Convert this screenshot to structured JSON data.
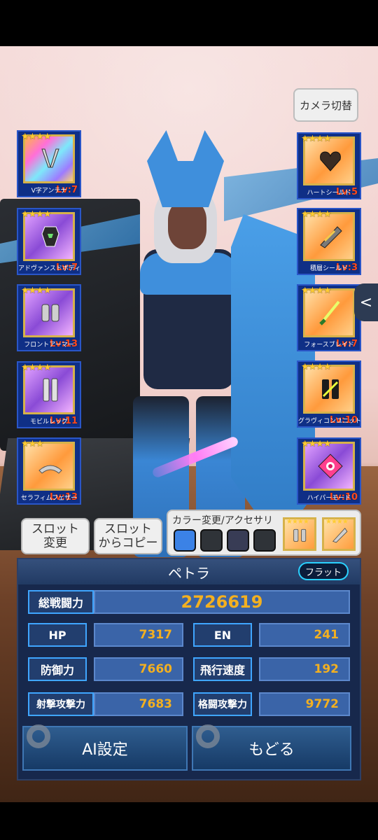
{
  "camera_button": "カメラ切替",
  "left_parts": [
    {
      "stars": "★★★★",
      "level": "Lv:7",
      "name": "V字アンテナ"
    },
    {
      "stars": "★★★★",
      "level": "Lv:7",
      "name": "アドヴァンスドボディ"
    },
    {
      "stars": "★★★★",
      "level": "Lv:13",
      "name": "フロントアーマー"
    },
    {
      "stars": "★★★★",
      "level": "Lv:11",
      "name": "モビルレッグ"
    },
    {
      "stars": "★★★",
      "level": "Lv:13",
      "name": "セラフィムフェザー"
    }
  ],
  "right_parts": [
    {
      "stars": "★★★★",
      "level": "Lv:5",
      "name": "ハートシールド"
    },
    {
      "stars": "★★★★",
      "level": "Lv:3",
      "name": "積層シールド"
    },
    {
      "stars": "★★★★",
      "level": "Lv:7",
      "name": "フォースブレイド"
    },
    {
      "stars": "★★★★",
      "level": "Lv:10",
      "name": "グラヴィコンユニット"
    },
    {
      "stars": "★★★★",
      "level": "Lv:10",
      "name": "ハイパーモード"
    }
  ],
  "side_tab": "<",
  "slot_change": "スロット\n変更",
  "slot_copy": "スロット\nからコピー",
  "color_panel": {
    "title": "カラー変更/アクセサリ",
    "swatches": [
      "#3b82e6",
      "#2f3338",
      "#383c55",
      "#2f3338"
    ],
    "accessory_stars": [
      "★★★★",
      "★★★★"
    ]
  },
  "character": {
    "name": "ペトラ",
    "mode": "フラット",
    "total_label": "総戦闘力",
    "total_value": "2726619",
    "stats": [
      {
        "label": "HP",
        "value": "7317"
      },
      {
        "label": "EN",
        "value": "241"
      },
      {
        "label": "防御力",
        "value": "7660"
      },
      {
        "label": "飛行速度",
        "value": "192"
      },
      {
        "label": "射撃攻撃力",
        "value": "7683"
      },
      {
        "label": "格闘攻撃力",
        "value": "9772"
      }
    ]
  },
  "buttons": {
    "ai": "AI設定",
    "back": "もどる"
  }
}
